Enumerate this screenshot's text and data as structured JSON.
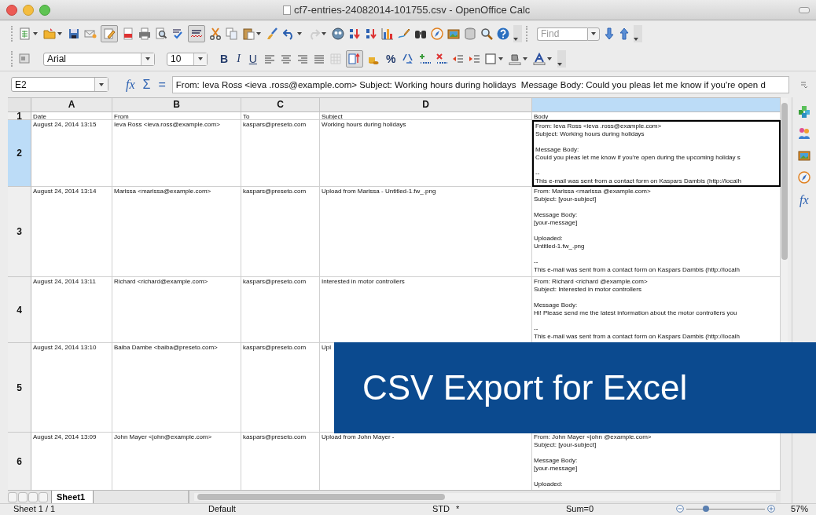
{
  "window": {
    "title": "cf7-entries-24082014-101755.csv - OpenOffice Calc"
  },
  "find": {
    "placeholder": "Find"
  },
  "font": {
    "name": "Arial",
    "size": "10"
  },
  "format_buttons": [
    {
      "label": "B",
      "kind": "bold"
    },
    {
      "label": "I",
      "kind": "italic"
    },
    {
      "label": "U",
      "kind": "underline"
    }
  ],
  "percent_button": "%",
  "formula_bar": {
    "cell": "E2",
    "function_symbol": "fx",
    "sum_symbol": "Σ",
    "equals": "=",
    "content": "From: Ieva Ross <ieva .ross@example.com> Subject: Working hours during holidays  Message Body: Could you pleas let me know if you're open d"
  },
  "sheet": {
    "columns": [
      {
        "label": "A",
        "selected": false
      },
      {
        "label": "B",
        "selected": false
      },
      {
        "label": "C",
        "selected": false
      },
      {
        "label": "D",
        "selected": false
      },
      {
        "selected": true
      }
    ],
    "rows": [
      {
        "number": "1",
        "selected": false,
        "cells": [
          "Date",
          "From",
          "To",
          "Subject"
        ],
        "body": [
          [
            "Body"
          ]
        ]
      },
      {
        "number": "2",
        "selected": true,
        "cells": [
          "August 24, 2014 13:15",
          "Ieva Ross <ieva.ross@example.com>",
          "kaspars@preseto.com",
          "Working hours during holidays"
        ],
        "body": [
          [
            "From: Ieva Ross <ieva .ross@example.com>",
            "Subject: Working hours during holidays"
          ],
          [
            "Message Body:",
            "Could you pleas let me know if you're open during the upcoming holiday s"
          ],
          [
            "--",
            "This e-mail was sent from a contact form on Kaspars Dambis (http://localh"
          ]
        ]
      },
      {
        "number": "3",
        "selected": false,
        "cells": [
          "August 24, 2014 13:14",
          "Marissa <marissa@example.com>",
          "kaspars@preseto.com",
          "Upload from Marissa - Untitled-1.fw_.png"
        ],
        "body": [
          [
            "From: Marissa <marissa @example.com>",
            "Subject: [your-subject]"
          ],
          [
            "Message Body:",
            "[your-message]"
          ],
          [
            "Uploaded:",
            "Untitled-1.fw_.png"
          ],
          [
            "--",
            "This e-mail was sent from a contact form on Kaspars Dambis (http://localh"
          ]
        ]
      },
      {
        "number": "4",
        "selected": false,
        "cells": [
          "August 24, 2014 13:11",
          "Richard <richard@example.com>",
          "kaspars@preseto.com",
          "Interested in motor controllers"
        ],
        "body": [
          [
            "From: Richard <richard @example.com>",
            "Subject: Interested in motor controllers"
          ],
          [
            "Message Body:",
            "Hi! Please send me the latest information about the motor controllers you"
          ],
          [
            "--",
            "This e-mail was sent from a contact form on Kaspars Dambis (http://localh"
          ]
        ]
      },
      {
        "number": "5",
        "selected": false,
        "cells": [
          "August 24, 2014 13:10",
          "Baiba Dambe <baiba@preseto.com>",
          "kaspars@preseto.com",
          "Upl"
        ]
      },
      {
        "number": "6",
        "selected": false,
        "cells": [
          "August 24, 2014 13:09",
          "John Mayer <john@example.com>",
          "kaspars@preseto.com",
          "Upload from John Mayer -"
        ],
        "body": [
          [
            "From: John Mayer <john @example.com>",
            "Subject: [your-subject]"
          ],
          [
            "Message Body:",
            "[your-message]"
          ],
          [
            "Uploaded:"
          ]
        ]
      }
    ]
  },
  "sidebar": {
    "function_symbol": "fx"
  },
  "sheet_tabs": [
    {
      "label": "Sheet1",
      "selected": true
    }
  ],
  "status_bar": {
    "sheet": "Sheet 1 / 1",
    "style": "Default",
    "mode": "STD",
    "modified": "*",
    "sum": "Sum=0",
    "zoom": {
      "level": 0.25,
      "reading": "57%"
    }
  },
  "banner": {
    "text": "CSV Export for Excel"
  }
}
